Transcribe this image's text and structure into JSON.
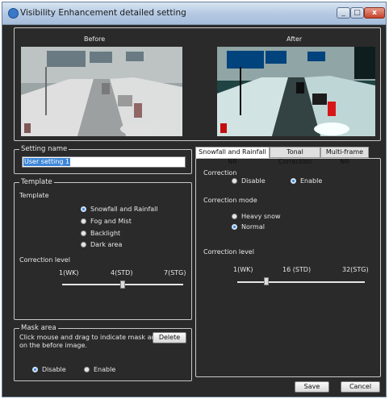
{
  "window": {
    "title": "Visibility Enhancement detailed setting",
    "min_glyph": "_",
    "max_glyph": "□",
    "close_glyph": "x"
  },
  "preview": {
    "before_label": "Before",
    "after_label": "After"
  },
  "setting_name": {
    "legend": "Setting name",
    "value": "User setting 1"
  },
  "template": {
    "legend": "Template",
    "label": "Template",
    "options": [
      "Snowfall and Rainfall",
      "Fog and Mist",
      "Backlight",
      "Dark area"
    ],
    "selected": 0,
    "correction_level_label": "Correction level",
    "ticks": [
      "1(WK)",
      "4(STD)",
      "7(STG)"
    ],
    "level_value": 4
  },
  "mask_area": {
    "legend": "Mask area",
    "instruction_line1": "Click mouse and drag to indicate mask area",
    "instruction_line2": "on the before image.",
    "delete_label": "Delete",
    "disable_label": "Disable",
    "enable_label": "Enable",
    "selected": "Disable"
  },
  "tabs": [
    "Snowfall and Rainfall NR",
    "Tonal Correction",
    "Multi-frame NR"
  ],
  "active_tab": 0,
  "nr_panel": {
    "correction_label": "Correction",
    "disable_label": "Disable",
    "enable_label": "Enable",
    "correction_selected": "Enable",
    "mode_label": "Correction mode",
    "mode_options": [
      "Heavy snow",
      "Normal"
    ],
    "mode_selected": "Normal",
    "level_label": "Correction level",
    "ticks": [
      "1(WK)",
      "16 (STD)",
      "32(STG)"
    ],
    "level_value": 16
  },
  "footer": {
    "save_label": "Save",
    "cancel_label": "Cancel"
  },
  "colors": {
    "dialog_bg": "#2a2a2a",
    "accent": "#3d86d8",
    "title_bar": "#b3c8e2"
  }
}
